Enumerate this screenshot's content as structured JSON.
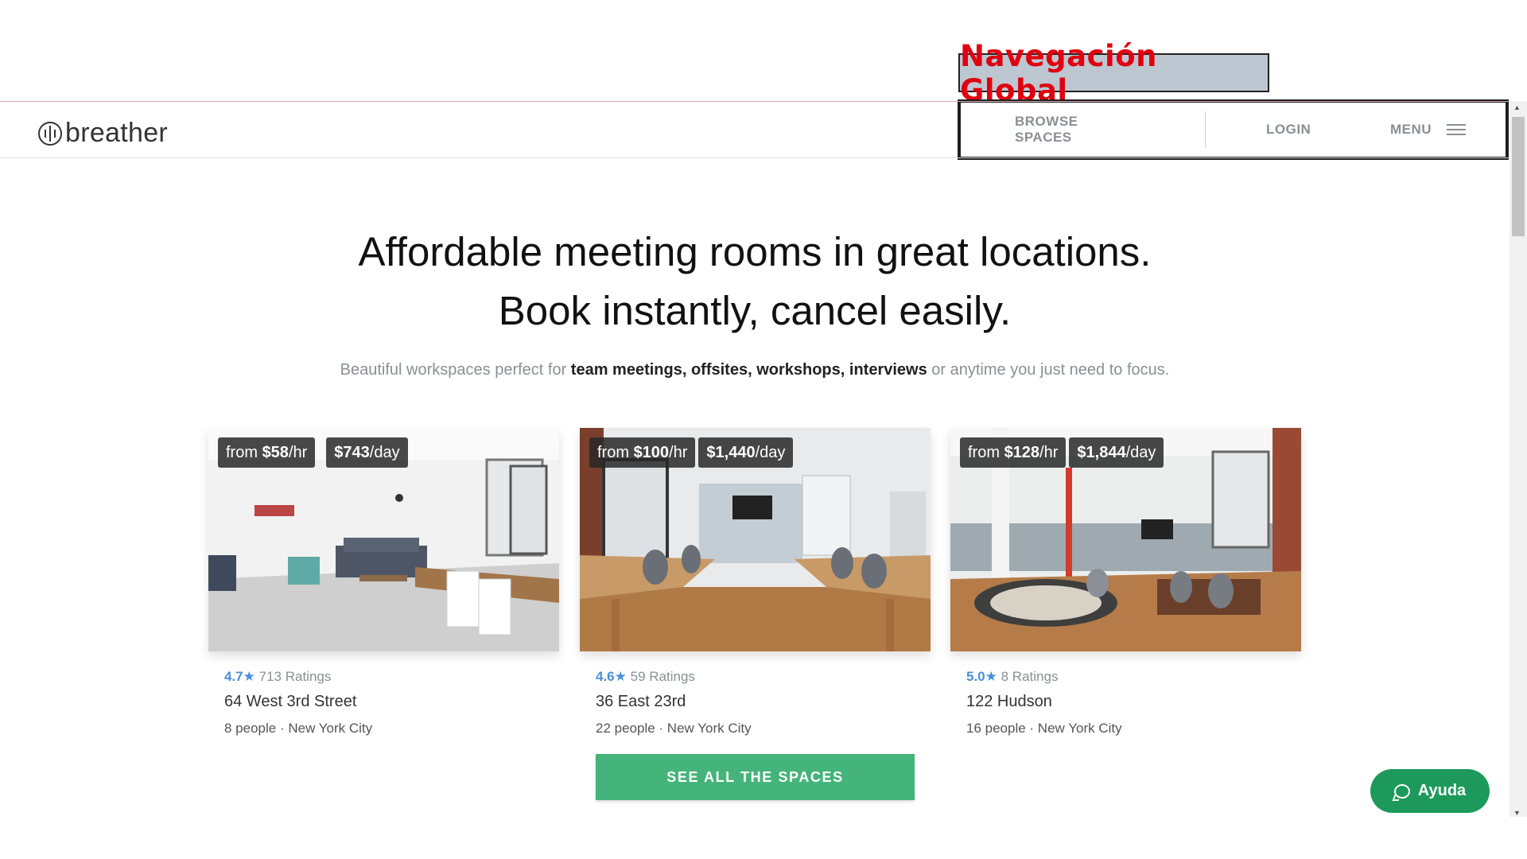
{
  "annotation": {
    "label": "Navegación Global"
  },
  "header": {
    "logo_text": "breather",
    "nav": {
      "browse": "BROWSE SPACES",
      "login": "LOGIN",
      "menu": "MENU"
    }
  },
  "hero": {
    "title_line1": "Affordable meeting rooms in great locations.",
    "title_line2": "Book instantly, cancel easily.",
    "sub_prefix": "Beautiful workspaces perfect for ",
    "sub_bold": "team meetings, offsites, workshops, interviews",
    "sub_suffix": " or anytime you just need to focus."
  },
  "cards": [
    {
      "from_text": "from ",
      "hourly": "$58",
      "hourly_unit": "/hr",
      "daily": "$743",
      "daily_unit": "/day",
      "score": "4.7",
      "star": "★",
      "ratings": "713 Ratings",
      "address": "64 West 3rd Street",
      "meta": "8 people · New York City"
    },
    {
      "from_text": "from ",
      "hourly": "$100",
      "hourly_unit": "/hr",
      "daily": "$1,440",
      "daily_unit": "/day",
      "score": "4.6",
      "star": "★",
      "ratings": "59 Ratings",
      "address": "36 East 23rd",
      "meta": "22 people · New York City"
    },
    {
      "from_text": "from ",
      "hourly": "$128",
      "hourly_unit": "/hr",
      "daily": "$1,844",
      "daily_unit": "/day",
      "score": "5.0",
      "star": "★",
      "ratings": "8 Ratings",
      "address": "122 Hudson",
      "meta": "16 people · New York City"
    }
  ],
  "cta": {
    "label": "SEE ALL THE SPACES"
  },
  "help": {
    "label": "Ayuda",
    "icon": "chat-bubble-icon"
  },
  "colors": {
    "accent_green": "#44b47a",
    "help_green": "#1d9a5b",
    "rating_blue": "#4a8fd8",
    "annotation_red": "#e0000f"
  }
}
